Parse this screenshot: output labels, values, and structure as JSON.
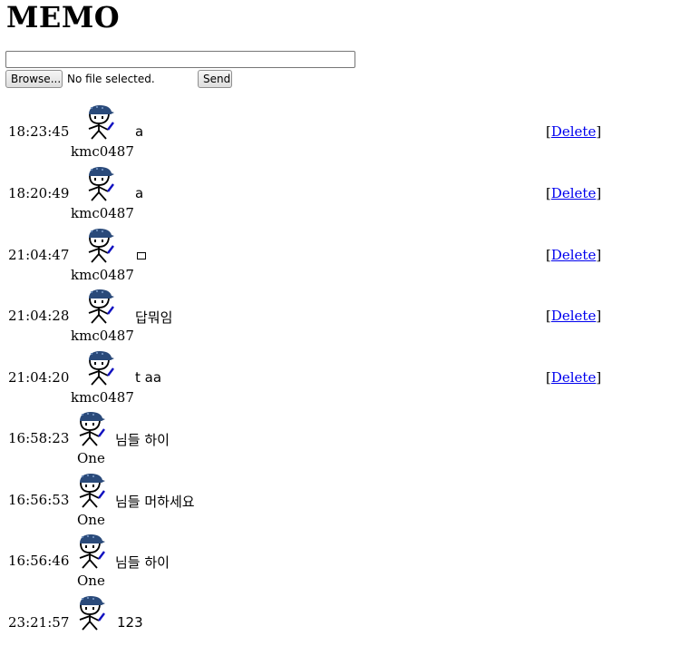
{
  "page": {
    "title": "MEMO"
  },
  "form": {
    "memo_value": "",
    "browse_label": "Browse...",
    "file_status": "No file selected.",
    "send_label": "Send"
  },
  "entries": [
    {
      "time": "18:23:45",
      "user": "kmc0487",
      "message": "a",
      "delete_label": "Delete",
      "deletable": true
    },
    {
      "time": "18:20:49",
      "user": "kmc0487",
      "message": "a",
      "delete_label": "Delete",
      "deletable": true
    },
    {
      "time": "21:04:47",
      "user": "kmc0487",
      "message": "",
      "delete_label": "Delete",
      "deletable": true
    },
    {
      "time": "21:04:28",
      "user": "kmc0487",
      "message": "답뭐임",
      "delete_label": "Delete",
      "deletable": true
    },
    {
      "time": "21:04:20",
      "user": "kmc0487",
      "message": "t aa",
      "delete_label": "Delete",
      "deletable": true
    },
    {
      "time": "16:58:23",
      "user": "One",
      "message": "님들 하이",
      "deletable": false
    },
    {
      "time": "16:56:53",
      "user": "One",
      "message": "님들 머하세요",
      "deletable": false
    },
    {
      "time": "16:56:46",
      "user": "One",
      "message": "님들 하이",
      "deletable": false
    },
    {
      "time": "23:21:57",
      "user": "",
      "message": "123",
      "deletable": false
    }
  ],
  "icons": {
    "avatar": "stick-figure-avatar-icon"
  },
  "colors": {
    "link": "#0000ee",
    "avatar_hat": "#2a4a7a",
    "avatar_accent": "#1010c0"
  }
}
